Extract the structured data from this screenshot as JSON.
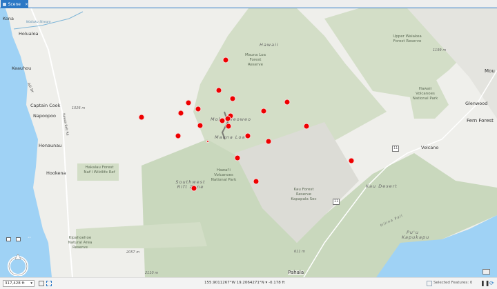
{
  "tab": {
    "label": "Scene",
    "close": "×"
  },
  "map": {
    "labels": {
      "kona": "Kona",
      "holualoa": "Holualoa",
      "keauhou": "Keauhou",
      "alii": "Alii Dr",
      "captain_cook": "Captain Cook",
      "napoopoo": "Napoopoo",
      "honaunau": "Honaunau",
      "hookena": "Hookena",
      "hawaii_belt": "Hawaii Belt Rd",
      "wailuku": "Wailuku Stream",
      "e1026": "1026 m",
      "hakalau": "Hakalau Forest Nat'l Wildlife Ref",
      "kipahoehoe": "Kipahoehoe Natural Area Reserve",
      "e2057": "2057 m",
      "e2110": "2110 m",
      "hawaii": "Hawaii",
      "mauna_loa_fr": "Mauna Loa Forest Reserve",
      "mokuaweoweo": "Mokuaweoweo",
      "mauna_loa": "Mauna Loa",
      "hvnp1": "Hawai'i Volcanoes National Park",
      "sw_rift": "Southwest Rift Zone",
      "kau_forest": "Kau Forest Reserve Kapapala Sec",
      "e611": "611 m",
      "pahala": "Pahala",
      "upper_waiakea": "Upper Waiakea Forest Reserve",
      "e1199": "1199 m",
      "hvnp2": "Hawaii Volcanoes National Park",
      "glenwood": "Glenwood",
      "fern_forest": "Fern Forest",
      "mountain_view": "Mou",
      "volcano": "Volcano",
      "kau_desert": "Kau Desert",
      "puu_kapukapu": "Pu'u Kapukapu",
      "hilina_pali": "Hilina Pali",
      "hwy11": "11"
    },
    "point_color": "#ee0000",
    "ocean_color": "#9fd2f5",
    "park_color": "#cfdcc3",
    "point_count": 23
  },
  "status": {
    "scale": "317,428 ft",
    "coords": "155.9011267°W 19.2064271°N",
    "elev": "-0.178 ft",
    "selected": "Selected Features: 0"
  }
}
